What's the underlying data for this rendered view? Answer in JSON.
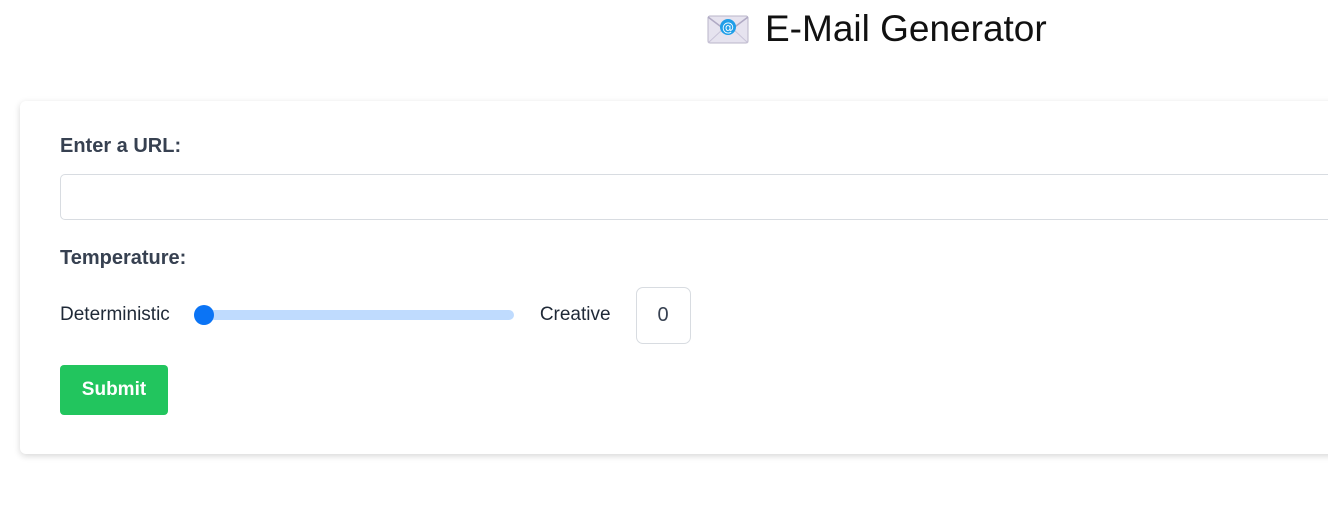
{
  "header": {
    "icon": "envelope-at-icon",
    "title": "E-Mail Generator"
  },
  "form": {
    "url_label": "Enter a URL:",
    "url_value": "",
    "url_placeholder": "",
    "temperature_label": "Temperature:",
    "slider": {
      "left_label": "Deterministic",
      "right_label": "Creative",
      "value": "0",
      "min": 0,
      "max": 1
    },
    "submit_label": "Submit"
  },
  "colors": {
    "accent": "#0b74f5",
    "track": "#bfdbfe",
    "submit": "#22c55e",
    "label_text": "#374151"
  }
}
